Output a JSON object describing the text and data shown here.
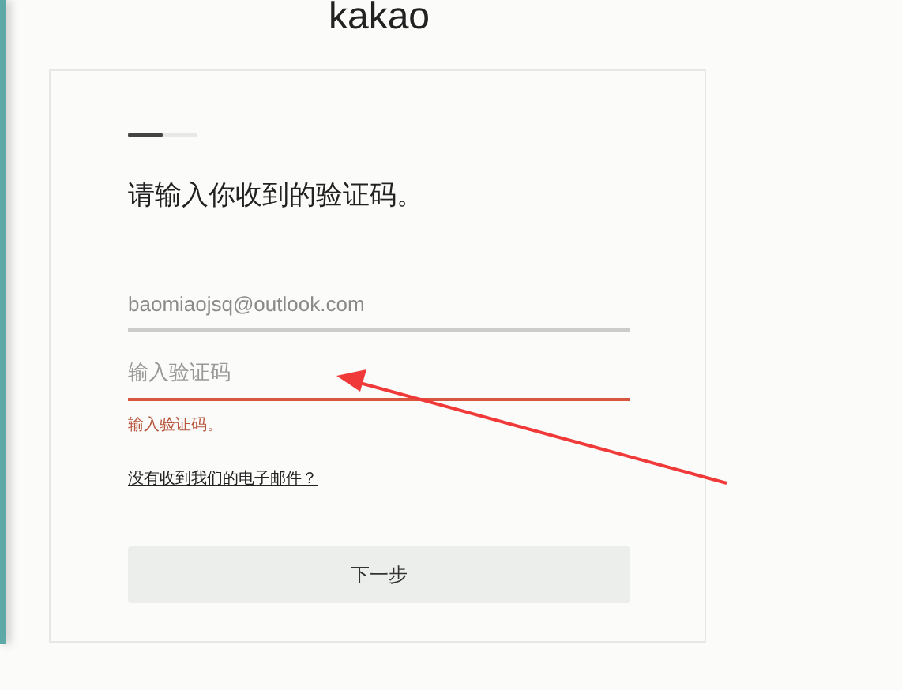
{
  "logo": "kakao",
  "progress": {
    "level": 0.5
  },
  "title": "请输入你收到的验证码。",
  "email_field": {
    "value": "baomiaojsq@outlook.com"
  },
  "code_field": {
    "placeholder": "输入验证码",
    "error": true,
    "error_message": "输入验证码。"
  },
  "help_link": "没有收到我们的电子邮件？",
  "buttons": [
    "下一步"
  ]
}
